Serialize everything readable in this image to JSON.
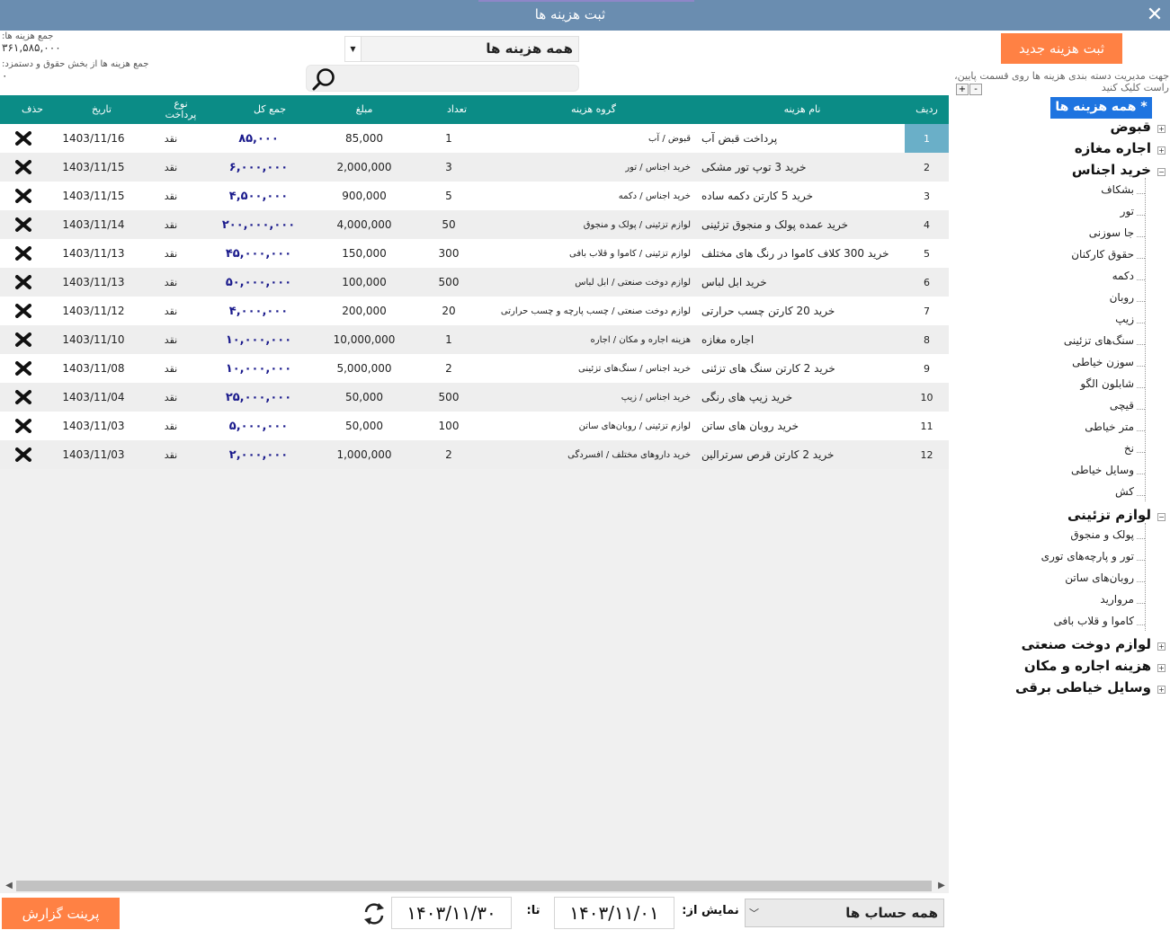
{
  "window": {
    "title": "ثبت هزینه ها",
    "close_icon": "✕"
  },
  "totals": {
    "all_label": "جمع هزینه ها:",
    "all_value": "۳۶۱,۵۸۵,۰۰۰",
    "payroll_label": "جمع هزینه ها از بخش حقوق و دستمزد:",
    "payroll_value": "۰"
  },
  "filter": {
    "selected": "همه هزینه ها"
  },
  "search": {
    "placeholder": ""
  },
  "table": {
    "columns": [
      "ردیف",
      "نام هزینه",
      "گروه هزینه",
      "تعداد",
      "مبلغ",
      "جمع کل",
      "نوع پرداخت",
      "تاریخ",
      "حذف"
    ],
    "rows": [
      {
        "idx": "1",
        "name": "پرداخت قبض آب",
        "group": "قبوض / آب",
        "count": "1",
        "amount": "85,000",
        "total": "۸۵,۰۰۰",
        "pay": "نقد",
        "date": "1403/11/16"
      },
      {
        "idx": "2",
        "name": "خرید 3 توپ تور مشکی",
        "group": "خرید اجناس / تور",
        "count": "3",
        "amount": "2,000,000",
        "total": "۶,۰۰۰,۰۰۰",
        "pay": "نقد",
        "date": "1403/11/15"
      },
      {
        "idx": "3",
        "name": "خرید 5 کارتن دکمه ساده",
        "group": "خرید اجناس / دکمه",
        "count": "5",
        "amount": "900,000",
        "total": "۴,۵۰۰,۰۰۰",
        "pay": "نقد",
        "date": "1403/11/15"
      },
      {
        "idx": "4",
        "name": "خرید عمده پولک و منجوق تزئینی",
        "group": "لوازم تزئینی / پولک و منجوق",
        "count": "50",
        "amount": "4,000,000",
        "total": "۲۰۰,۰۰۰,۰۰۰",
        "pay": "نقد",
        "date": "1403/11/14"
      },
      {
        "idx": "5",
        "name": "خرید 300 کلاف کاموا در رنگ های مختلف",
        "group": "لوازم تزئینی / کاموا و قلاب بافی",
        "count": "300",
        "amount": "150,000",
        "total": "۴۵,۰۰۰,۰۰۰",
        "pay": "نقد",
        "date": "1403/11/13"
      },
      {
        "idx": "6",
        "name": "خرید ابل لباس",
        "group": "لوازم دوخت صنعتی / ابل لباس",
        "count": "500",
        "amount": "100,000",
        "total": "۵۰,۰۰۰,۰۰۰",
        "pay": "نقد",
        "date": "1403/11/13"
      },
      {
        "idx": "7",
        "name": "خرید 20 کارتن چسب حرارتی",
        "group": "لوازم دوخت صنعتی / چسب پارچه و چسب حرارتی",
        "count": "20",
        "amount": "200,000",
        "total": "۴,۰۰۰,۰۰۰",
        "pay": "نقد",
        "date": "1403/11/12"
      },
      {
        "idx": "8",
        "name": "اجاره مغازه",
        "group": "هزینه اجاره و مکان / اجاره",
        "count": "1",
        "amount": "10,000,000",
        "total": "۱۰,۰۰۰,۰۰۰",
        "pay": "نقد",
        "date": "1403/11/10"
      },
      {
        "idx": "9",
        "name": "خرید 2 کارتن سنگ های تزئنی",
        "group": "خرید اجناس / سنگ‌های تزئینی",
        "count": "2",
        "amount": "5,000,000",
        "total": "۱۰,۰۰۰,۰۰۰",
        "pay": "نقد",
        "date": "1403/11/08"
      },
      {
        "idx": "10",
        "name": "خرید زیپ های رنگی",
        "group": "خرید اجناس / زیپ",
        "count": "500",
        "amount": "50,000",
        "total": "۲۵,۰۰۰,۰۰۰",
        "pay": "نقد",
        "date": "1403/11/04"
      },
      {
        "idx": "11",
        "name": "خرید روبان های ساتن",
        "group": "لوازم تزئینی / روبان‌های ساتن",
        "count": "100",
        "amount": "50,000",
        "total": "۵,۰۰۰,۰۰۰",
        "pay": "نقد",
        "date": "1403/11/03"
      },
      {
        "idx": "12",
        "name": "خرید 2 کارتن قرص سرترالین",
        "group": "خرید داروهای مختلف / افسردگی",
        "count": "2",
        "amount": "1,000,000",
        "total": "۲,۰۰۰,۰۰۰",
        "pay": "نقد",
        "date": "1403/11/03"
      }
    ]
  },
  "bottom": {
    "print_label": "پرینت گزارش",
    "to_label": "تا:",
    "to_date": "۱۴۰۳/۱۱/۳۰",
    "from_label": "نمایش از:",
    "from_date": "۱۴۰۳/۱۱/۰۱",
    "account_selected": "همه حساب ها"
  },
  "right": {
    "new_button": "ثبت هزینه جدید",
    "hint": "جهت مدیریت دسته بندی هزینه ها روی قسمت پایین، راست کلیک کنید",
    "expand_all": "+",
    "collapse_all": "-",
    "tree_root": "* همه هزینه ها *",
    "tree": [
      {
        "label": "قبوض",
        "level": 0,
        "state": "collapsed"
      },
      {
        "label": "اجاره مغازه",
        "level": 0,
        "state": "collapsed"
      },
      {
        "label": "خرید اجناس",
        "level": 0,
        "state": "expanded"
      },
      {
        "label": "بشکاف",
        "level": 1
      },
      {
        "label": "تور",
        "level": 1
      },
      {
        "label": "جا سوزنی",
        "level": 1
      },
      {
        "label": "حقوق کارکنان",
        "level": 1
      },
      {
        "label": "دکمه",
        "level": 1
      },
      {
        "label": "روبان",
        "level": 1
      },
      {
        "label": "زیپ",
        "level": 1
      },
      {
        "label": "سنگ‌های تزئینی",
        "level": 1
      },
      {
        "label": "سوزن خیاطی",
        "level": 1
      },
      {
        "label": "شابلون الگو",
        "level": 1
      },
      {
        "label": "قیچی",
        "level": 1
      },
      {
        "label": "متر خیاطی",
        "level": 1
      },
      {
        "label": "نخ",
        "level": 1
      },
      {
        "label": "وسایل خیاطی",
        "level": 1
      },
      {
        "label": "کش",
        "level": 1
      },
      {
        "label": "لوازم تزئینی",
        "level": 0,
        "state": "expanded"
      },
      {
        "label": "پولک و منجوق",
        "level": 1
      },
      {
        "label": "تور و پارچه‌های توری",
        "level": 1
      },
      {
        "label": "روبان‌های ساتن",
        "level": 1
      },
      {
        "label": "مروارید",
        "level": 1
      },
      {
        "label": "کاموا و قلاب بافی",
        "level": 1
      },
      {
        "label": "لوازم دوخت صنعتی",
        "level": 0,
        "state": "collapsed"
      },
      {
        "label": "هزینه اجاره و مکان",
        "level": 0,
        "state": "collapsed"
      },
      {
        "label": "وسایل خیاطی برقی",
        "level": 0,
        "state": "collapsed"
      }
    ]
  },
  "icons": {
    "delete": "delete-icon",
    "search": "search-icon",
    "refresh": "refresh-icon",
    "close": "close-icon"
  },
  "colors": {
    "titlebar": "#6a8db0",
    "header": "#0b8c86",
    "accent_orange": "#ff8144",
    "selection": "#6aafc8",
    "tree_root": "#1e74e0",
    "total_text": "#1a1a8c"
  }
}
